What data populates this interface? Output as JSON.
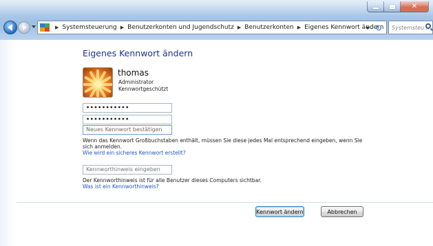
{
  "window": {
    "colors": {
      "accent": "#1e3287",
      "link": "#1f56c7",
      "close_button": "#c7432a"
    }
  },
  "addressbar": {
    "breadcrumbs": [
      "Systemsteuerung",
      "Benutzerkonten und Jugendschutz",
      "Benutzerkonten",
      "Eigenes Kennwort ändern"
    ],
    "icon": "control-panel-icon"
  },
  "search": {
    "placeholder": "Systemsteu..."
  },
  "main": {
    "title": "Eigenes Kennwort ändern",
    "user": {
      "name": "thomas",
      "role": "Administrator",
      "status": "Kennwortgeschützt",
      "avatar_icon": "flower-avatar-icon"
    },
    "fields": {
      "current_password": "•••••••••••",
      "new_password": "•••••••••••",
      "confirm_placeholder": "Neues Kennwort bestätigen",
      "hint_placeholder": "Kennworthinweis eingeben"
    },
    "info_line1": "Wenn das Kennwort Großbuchstaben enthält, müssen Sie diese jedes Mal entsprechend eingeben, wenn Sie",
    "info_line2": "sich anmelden.",
    "link_secure": "Wie wird ein sicheres Kennwort erstellt?",
    "hint_info": "Der Kennworthinweis ist für alle Benutzer dieses Computers sichtbar.",
    "link_hint": "Was ist ein Kennworthinweis?"
  },
  "footer": {
    "change_button": "Kennwort ändern",
    "cancel_button": "Abbrechen"
  }
}
